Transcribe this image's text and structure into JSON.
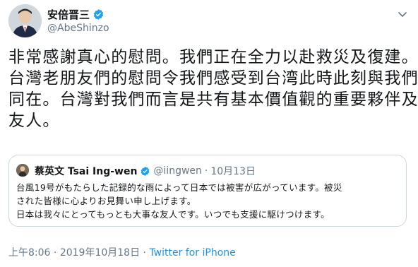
{
  "tweet": {
    "author": {
      "display_name": "安倍晋三",
      "handle": "@AbeShinzo",
      "verified": true
    },
    "text_lines": [
      "非常感謝真心的慰問。我們正在全力以赴救災及復建。",
      "台灣老朋友們的慰問令我們感受到台湾此時此刻與我們",
      "同在。台灣對我們而言是共有基本價值觀的重要夥伴及",
      "友人。"
    ],
    "meta": {
      "time": "上午8:06",
      "separator": " · ",
      "date": "2019年10月18日",
      "source": "Twitter for iPhone"
    }
  },
  "quote": {
    "author": {
      "display_name": "蔡英文 Tsai Ing-wen",
      "handle": "@iingwen",
      "verified": true
    },
    "dot": "·",
    "date": "10月13日",
    "text_lines": [
      "台風19号がもたらした記録的な雨によって日本では被害が広がっています。被災",
      "された皆様に心よりお見舞い申し上げます。",
      "日本は我々にとってもっとも大事な友人です。いつでも支援に駆けつけます。"
    ]
  },
  "colors": {
    "text": "#14171a",
    "secondary": "#657786",
    "link": "#1b95e0",
    "border": "#ccd6dd",
    "verified": "#1da1f2"
  },
  "icons": [
    "verified-badge-icon",
    "chevron-down-icon"
  ]
}
